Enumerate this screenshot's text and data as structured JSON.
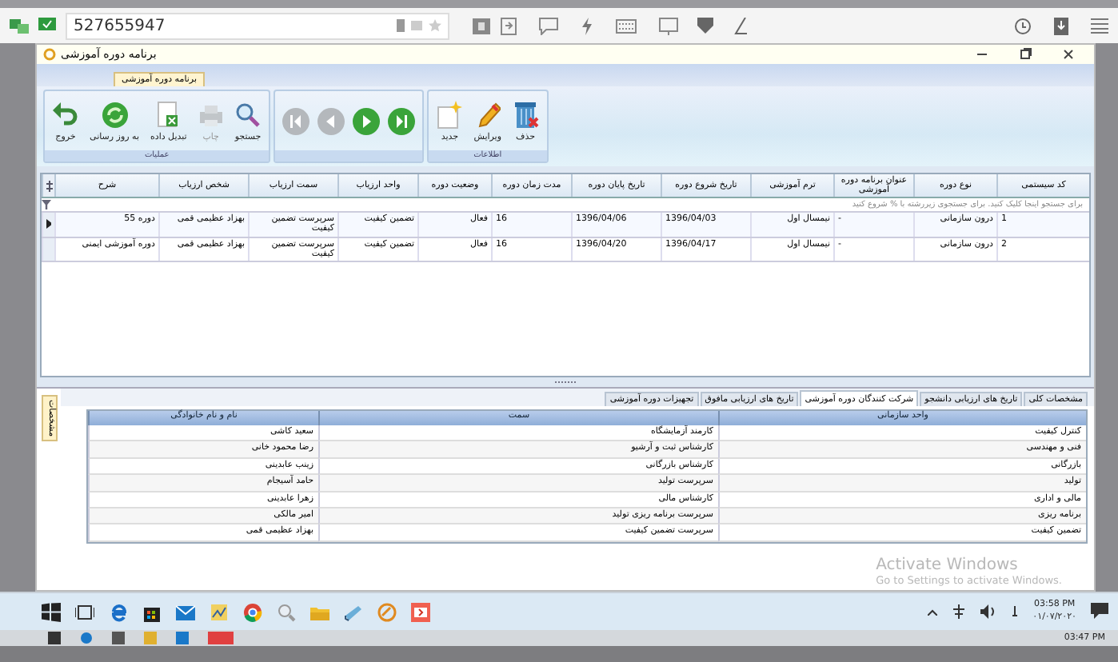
{
  "remote_bar": {
    "id": "527655947"
  },
  "window": {
    "title": "برنامه دوره آموزشی"
  },
  "ribbon": {
    "tab": "برنامه دوره آموزشی",
    "groups": [
      {
        "label": "اطلاعات",
        "buttons": [
          {
            "kind": "delete",
            "label": "حذف",
            "disabled": false
          },
          {
            "kind": "edit",
            "label": "ویرایش",
            "disabled": false
          },
          {
            "kind": "new",
            "label": "جدید",
            "disabled": false
          }
        ]
      },
      {
        "nav": [
          {
            "kind": "last",
            "disabled": false
          },
          {
            "kind": "next",
            "disabled": false
          },
          {
            "kind": "prev",
            "disabled": true
          },
          {
            "kind": "first",
            "disabled": true
          }
        ]
      },
      {
        "label": "عملیات",
        "buttons": [
          {
            "kind": "search",
            "label": "جستجو",
            "disabled": false
          },
          {
            "kind": "print",
            "label": "چاپ",
            "disabled": true
          },
          {
            "kind": "convert",
            "label": "تبدیل داده",
            "disabled": false
          },
          {
            "kind": "refresh",
            "label": "به روز رسانی",
            "disabled": false
          },
          {
            "kind": "exit",
            "label": "خروج",
            "disabled": false
          }
        ]
      }
    ]
  },
  "main_table": {
    "columns": [
      "کد سیستمی",
      "نوع دوره",
      "عنوان برنامه دوره آموزشی",
      "ترم آموزشی",
      "تاریخ شروع دوره",
      "تاریخ پایان دوره",
      "مدت زمان دوره",
      "وضعیت دوره",
      "واحد ارزیاب",
      "سمت ارزیاب",
      "شخص ارزیاب",
      "شرح"
    ],
    "filter_hint": "برای جستجو اینجا کلیک کنید. برای جستجوی زیررشته با % شروع کنید",
    "rows": [
      {
        "selected": true,
        "cells": [
          "1",
          "درون سازمانی",
          "-",
          "نیمسال اول",
          "1396/04/03",
          "1396/04/06",
          "16",
          "فعال",
          "تضمین کیفیت",
          "سرپرست تضمین کیفیت",
          "بهزاد عظیمی قمی",
          "دوره 55"
        ]
      },
      {
        "selected": false,
        "cells": [
          "2",
          "درون سازمانی",
          "-",
          "نیمسال اول",
          "1396/04/17",
          "1396/04/20",
          "16",
          "فعال",
          "تضمین کیفیت",
          "سرپرست تضمین کیفیت",
          "بهزاد عظیمی قمی",
          "دوره آموزشی ایمنی"
        ]
      }
    ]
  },
  "detail_tabs": [
    {
      "label": "مشخصات کلی",
      "selected": false
    },
    {
      "label": "تاریخ های ارزیابی دانشجو",
      "selected": false
    },
    {
      "label": "شرکت کنندگان دوره آموزشی",
      "selected": true
    },
    {
      "label": "تاریخ های ارزیابی مافوق",
      "selected": false
    },
    {
      "label": "تجهیزات دوره آموزشی",
      "selected": false
    }
  ],
  "side_tab": "مشخصات",
  "detail_table": {
    "columns": [
      "واحد سازمانی",
      "سمت",
      "نام و نام خانوادگی"
    ],
    "rows": [
      [
        "کنترل کیفیت",
        "کارمند آزمایشگاه",
        "سعید کاشی"
      ],
      [
        "فنی و مهندسی",
        "کارشناس ثبت و آرشیو",
        "رضا محمود خانی"
      ],
      [
        "بازرگانی",
        "کارشناس بازرگانی",
        "زینب عابدینی"
      ],
      [
        "تولید",
        "سرپرست تولید",
        "حامد آسیجام"
      ],
      [
        "مالی و اداری",
        "کارشناس مالی",
        "زهرا عابدینی"
      ],
      [
        "برنامه ریزی",
        "سرپرست برنامه ریزی تولید",
        "امیر مالکی"
      ],
      [
        "تضمین کیفیت",
        "سرپرست تضمین کیفیت",
        "بهزاد عظیمی قمی"
      ]
    ]
  },
  "activation_notice": {
    "title": "Activate Windows",
    "text": "Go to Settings to activate Windows."
  },
  "taskbar": {
    "time": "03:58 PM",
    "date": "۰۱/۰۷/۲۰۲۰"
  },
  "host_taskbar": {
    "time": "03:47 PM"
  }
}
